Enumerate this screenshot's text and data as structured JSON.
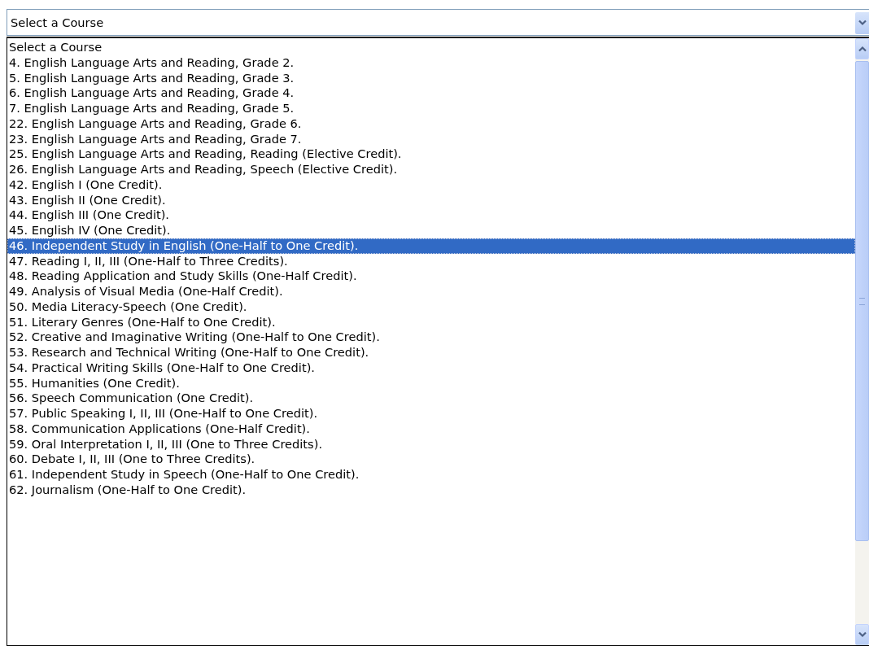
{
  "select": {
    "value": "Select a Course"
  },
  "options": [
    {
      "label": "Select a Course",
      "selected": false
    },
    {
      "label": "4. English Language Arts and Reading, Grade 2.",
      "selected": false
    },
    {
      "label": "5. English Language Arts and Reading, Grade 3.",
      "selected": false
    },
    {
      "label": "6. English Language Arts and Reading, Grade 4.",
      "selected": false
    },
    {
      "label": "7. English Language Arts and Reading, Grade 5.",
      "selected": false
    },
    {
      "label": "22. English Language Arts and Reading, Grade 6.",
      "selected": false
    },
    {
      "label": "23. English Language Arts and Reading, Grade 7.",
      "selected": false
    },
    {
      "label": "25. English Language Arts and Reading, Reading (Elective Credit).",
      "selected": false
    },
    {
      "label": "26. English Language Arts and Reading, Speech (Elective Credit).",
      "selected": false
    },
    {
      "label": "42. English I (One Credit).",
      "selected": false
    },
    {
      "label": "43. English II (One Credit).",
      "selected": false
    },
    {
      "label": "44. English III (One Credit).",
      "selected": false
    },
    {
      "label": "45. English IV (One Credit).",
      "selected": false
    },
    {
      "label": "46. Independent Study in English (One-Half to One Credit).",
      "selected": true
    },
    {
      "label": "47. Reading I, II, III (One-Half to Three Credits).",
      "selected": false
    },
    {
      "label": "48. Reading Application and Study Skills (One-Half Credit).",
      "selected": false
    },
    {
      "label": "49. Analysis of Visual Media (One-Half Credit).",
      "selected": false
    },
    {
      "label": "50. Media Literacy-Speech (One Credit).",
      "selected": false
    },
    {
      "label": "51. Literary Genres (One-Half to One Credit).",
      "selected": false
    },
    {
      "label": "52. Creative and Imaginative Writing (One-Half to One Credit).",
      "selected": false
    },
    {
      "label": "53. Research and Technical Writing (One-Half to One Credit).",
      "selected": false
    },
    {
      "label": "54. Practical Writing Skills (One-Half to One Credit).",
      "selected": false
    },
    {
      "label": "55. Humanities (One Credit).",
      "selected": false
    },
    {
      "label": "56. Speech Communication (One Credit).",
      "selected": false
    },
    {
      "label": "57. Public Speaking I, II, III (One-Half to One Credit).",
      "selected": false
    },
    {
      "label": "58. Communication Applications (One-Half Credit).",
      "selected": false
    },
    {
      "label": "59. Oral Interpretation I, II, III (One to Three Credits).",
      "selected": false
    },
    {
      "label": "60. Debate I, II, III (One to Three Credits).",
      "selected": false
    },
    {
      "label": "61. Independent Study in Speech (One-Half to One Credit).",
      "selected": false
    },
    {
      "label": "62. Journalism (One-Half to One Credit).",
      "selected": false
    }
  ]
}
